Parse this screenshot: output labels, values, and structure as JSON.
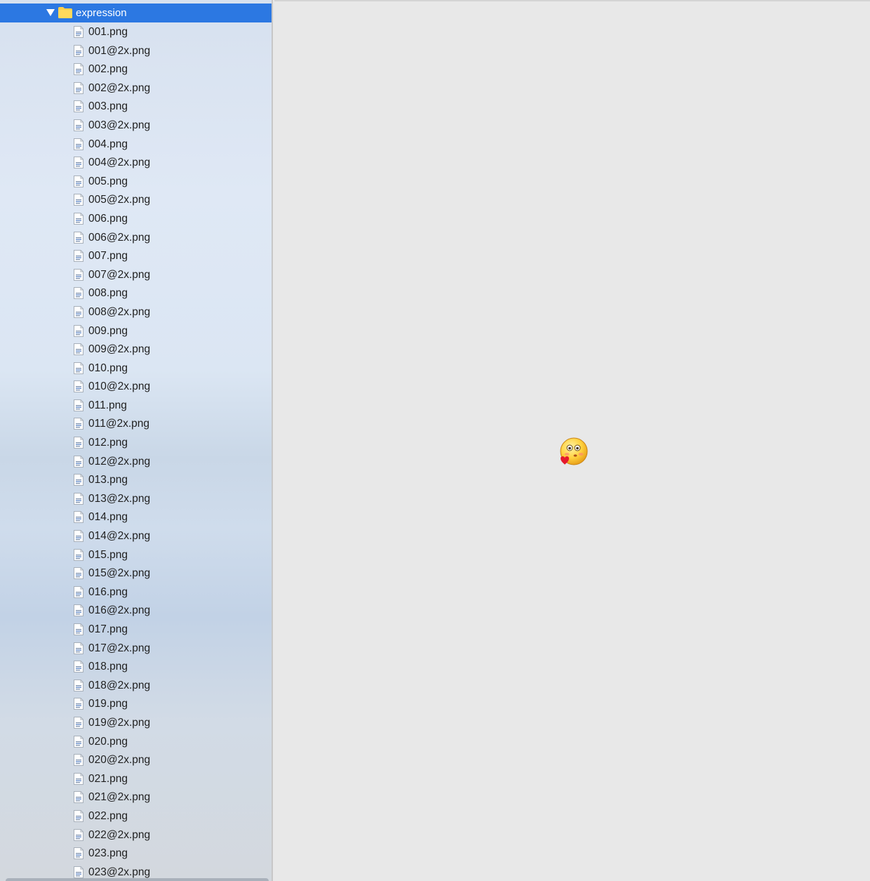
{
  "sidebar": {
    "folder": {
      "name": "expression",
      "expanded": true
    },
    "files": [
      "001.png",
      "001@2x.png",
      "002.png",
      "002@2x.png",
      "003.png",
      "003@2x.png",
      "004.png",
      "004@2x.png",
      "005.png",
      "005@2x.png",
      "006.png",
      "006@2x.png",
      "007.png",
      "007@2x.png",
      "008.png",
      "008@2x.png",
      "009.png",
      "009@2x.png",
      "010.png",
      "010@2x.png",
      "011.png",
      "011@2x.png",
      "012.png",
      "012@2x.png",
      "013.png",
      "013@2x.png",
      "014.png",
      "014@2x.png",
      "015.png",
      "015@2x.png",
      "016.png",
      "016@2x.png",
      "017.png",
      "017@2x.png",
      "018.png",
      "018@2x.png",
      "019.png",
      "019@2x.png",
      "020.png",
      "020@2x.png",
      "021.png",
      "021@2x.png",
      "022.png",
      "022@2x.png",
      "023.png",
      "023@2x.png"
    ],
    "selection_color": "#2c78e2"
  },
  "preview": {
    "image_icon": "blushing-emoji-with-heart-icon"
  }
}
